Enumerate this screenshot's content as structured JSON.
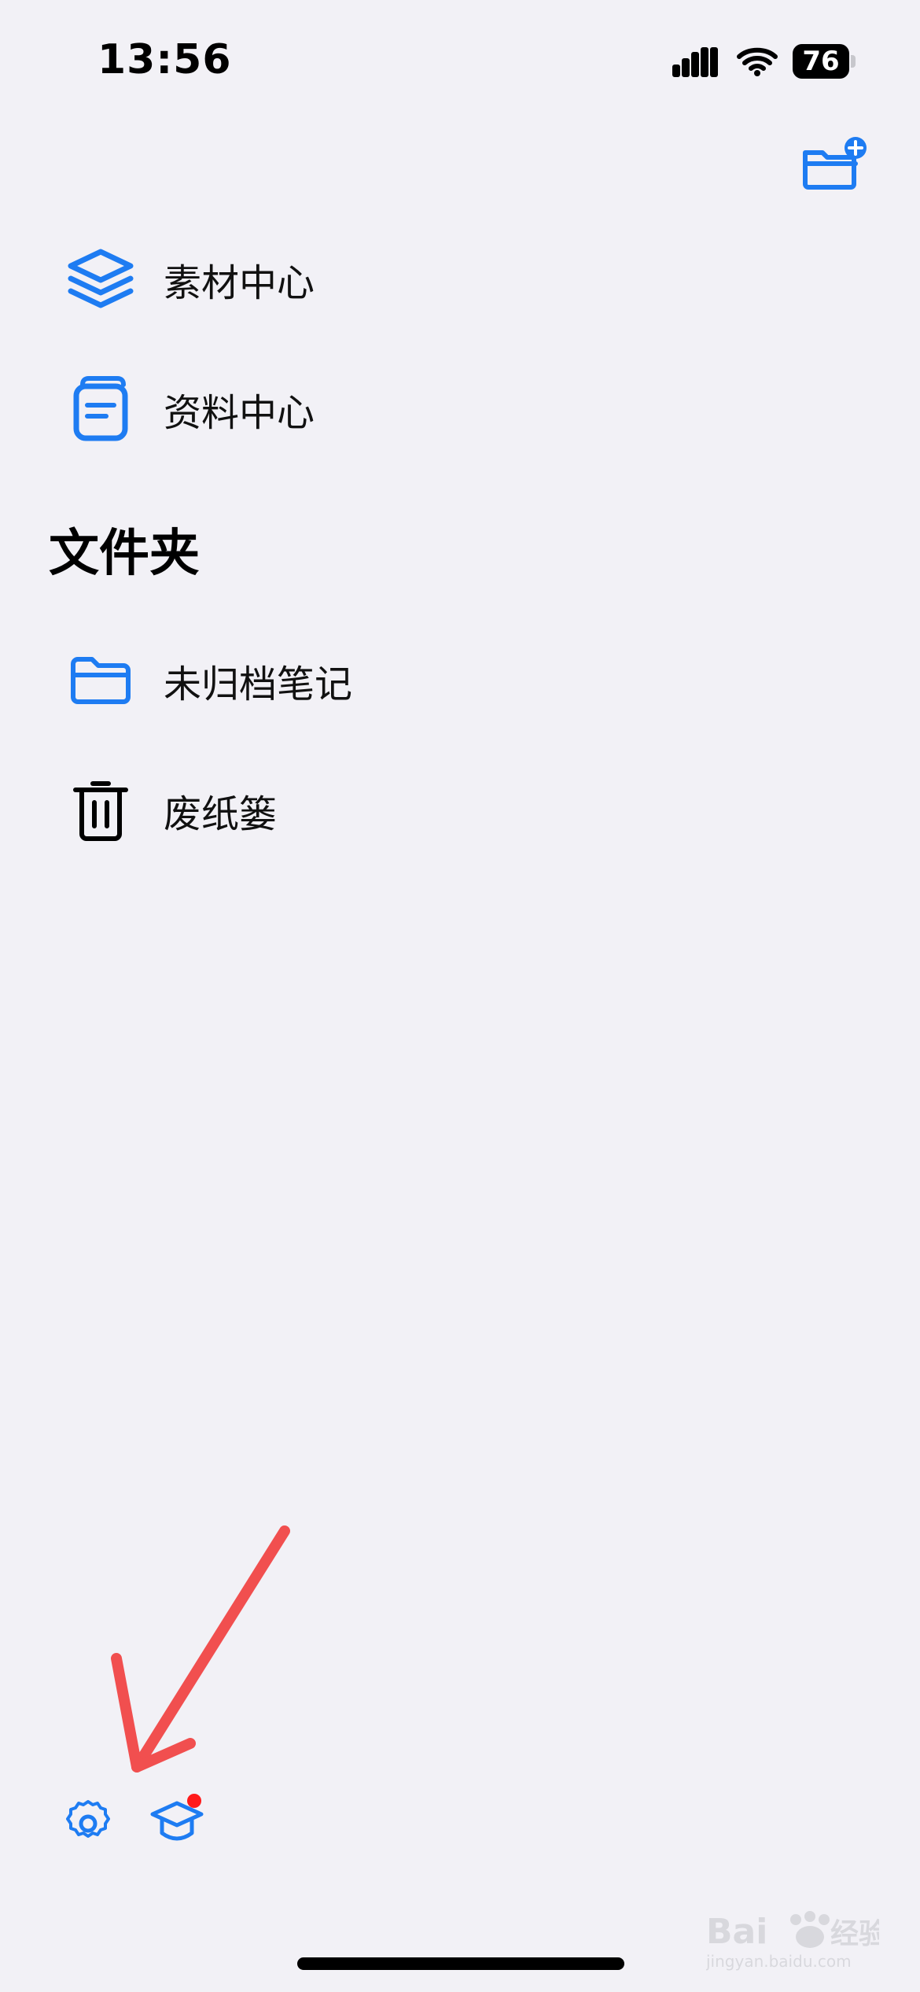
{
  "status_bar": {
    "time": "13:56",
    "battery_level": "76",
    "icons": [
      "signal-icon",
      "wifi-icon",
      "battery-icon"
    ]
  },
  "toolbar": {
    "new_folder_icon": "folder-plus-icon"
  },
  "library": {
    "items": [
      {
        "label": "素材中心",
        "icon": "layers-icon"
      },
      {
        "label": "资料中心",
        "icon": "document-stack-icon"
      }
    ]
  },
  "folders": {
    "title": "文件夹",
    "items": [
      {
        "label": "未归档笔记",
        "icon": "folder-icon"
      },
      {
        "label": "废纸篓",
        "icon": "trash-icon"
      }
    ]
  },
  "bottom": {
    "icons": [
      "gear-icon",
      "graduation-cap-icon"
    ],
    "badge": true
  },
  "annotation": {
    "arrow_color": "#F14F4F"
  },
  "colors": {
    "accent": "#1E7CF2",
    "background": "#F2F1F6",
    "text": "#111111",
    "badge": "#FF1A1A"
  },
  "watermark": {
    "text": "Baidu经验",
    "sub": "jingyan.baidu.com"
  }
}
